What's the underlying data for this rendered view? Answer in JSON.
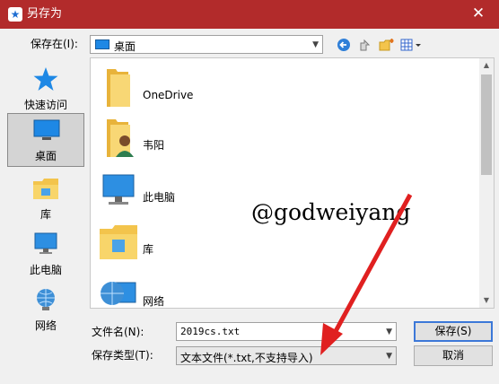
{
  "window": {
    "title": "另存为",
    "close_glyph": "✕"
  },
  "save_in": {
    "label": "保存在(I):",
    "value": "桌面"
  },
  "toolbar": {
    "back_icon": "back-arrow-icon",
    "up_icon": "up-folder-icon",
    "new_folder_icon": "new-folder-icon",
    "view_icon": "view-menu-icon"
  },
  "places": [
    {
      "label": "快速访问",
      "icon": "star-icon"
    },
    {
      "label": "桌面",
      "icon": "desktop-icon",
      "selected": true
    },
    {
      "label": "库",
      "icon": "library-icon"
    },
    {
      "label": "此电脑",
      "icon": "computer-icon"
    },
    {
      "label": "网络",
      "icon": "network-icon"
    }
  ],
  "files": [
    {
      "name": "OneDrive",
      "icon": "folder-icon"
    },
    {
      "name": "韦阳",
      "icon": "user-folder-icon"
    },
    {
      "name": "此电脑",
      "icon": "computer-icon"
    },
    {
      "name": "库",
      "icon": "library-icon"
    },
    {
      "name": "网络",
      "icon": "network-icon"
    }
  ],
  "filename": {
    "label": "文件名(N):",
    "value": "2019cs.txt"
  },
  "filetype": {
    "label": "保存类型(T):",
    "value": "文本文件(*.txt,不支持导入)"
  },
  "buttons": {
    "save": "保存(S)",
    "cancel": "取消"
  },
  "watermark": "@godweiyang",
  "colors": {
    "titlebar": "#b22b2b",
    "arrow": "#e02020",
    "accent": "#3c78d8"
  }
}
